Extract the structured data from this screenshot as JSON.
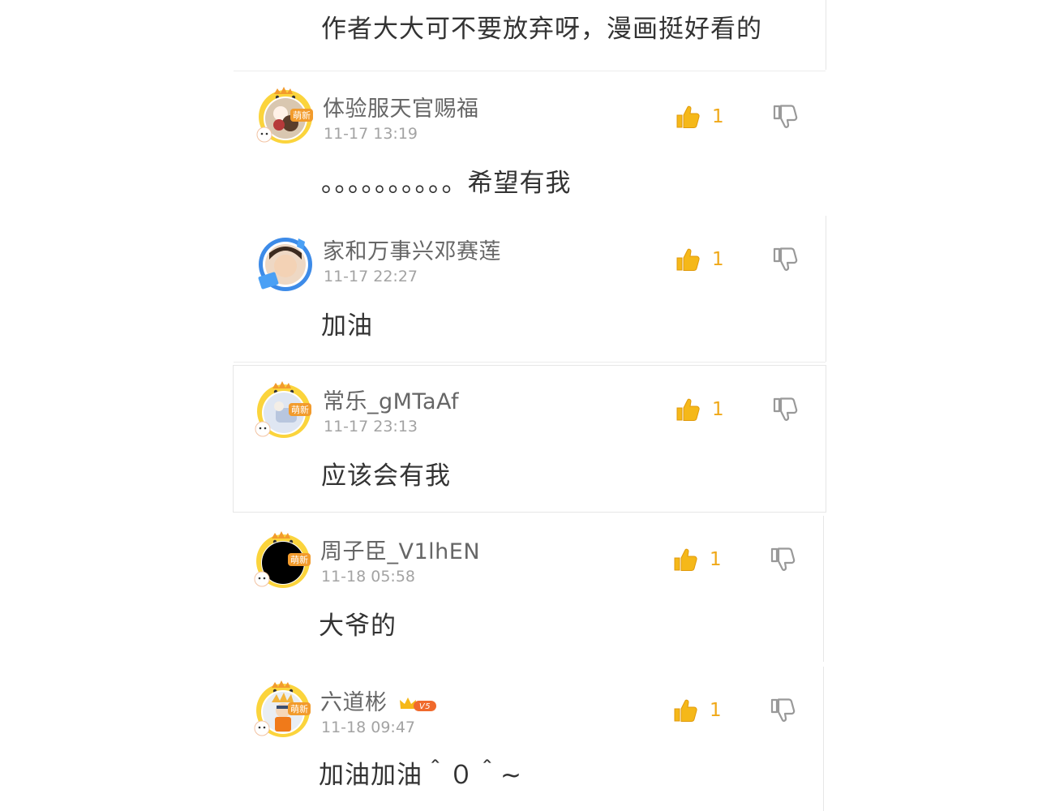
{
  "comments": [
    {
      "content": "作者大大可不要放弃呀，漫画挺好看的"
    },
    {
      "username": "体验服天官赐福",
      "timestamp": "11-17 13:19",
      "content": "。。。。。。。。。。希望有我",
      "likes": "1",
      "badge": "萌新"
    },
    {
      "username": "家和万事兴邓赛莲",
      "timestamp": "11-17 22:27",
      "content": "加油",
      "likes": "1"
    },
    {
      "username": "常乐_gMTaAf",
      "timestamp": "11-17 23:13",
      "content": "应该会有我",
      "likes": "1",
      "badge": "萌新"
    },
    {
      "username": "周子臣_V1lhEN",
      "timestamp": "11-18 05:58",
      "content": "大爷的",
      "likes": "1",
      "badge": "萌新"
    },
    {
      "username": "六道彬",
      "timestamp": "11-18 09:47",
      "content": "加油加油＾０＾~",
      "likes": "1",
      "badge": "萌新",
      "vip_level": "V5"
    }
  ],
  "colors": {
    "like": "#f5b819",
    "like_count": "#f0a818",
    "dislike": "#999999",
    "username": "#666666",
    "timestamp": "#a3a3a3",
    "content": "#333333",
    "border": "#e6e6e6"
  },
  "icons": {
    "like": "thumbs-up-icon",
    "dislike": "thumbs-down-icon",
    "vip": "crown-icon"
  }
}
